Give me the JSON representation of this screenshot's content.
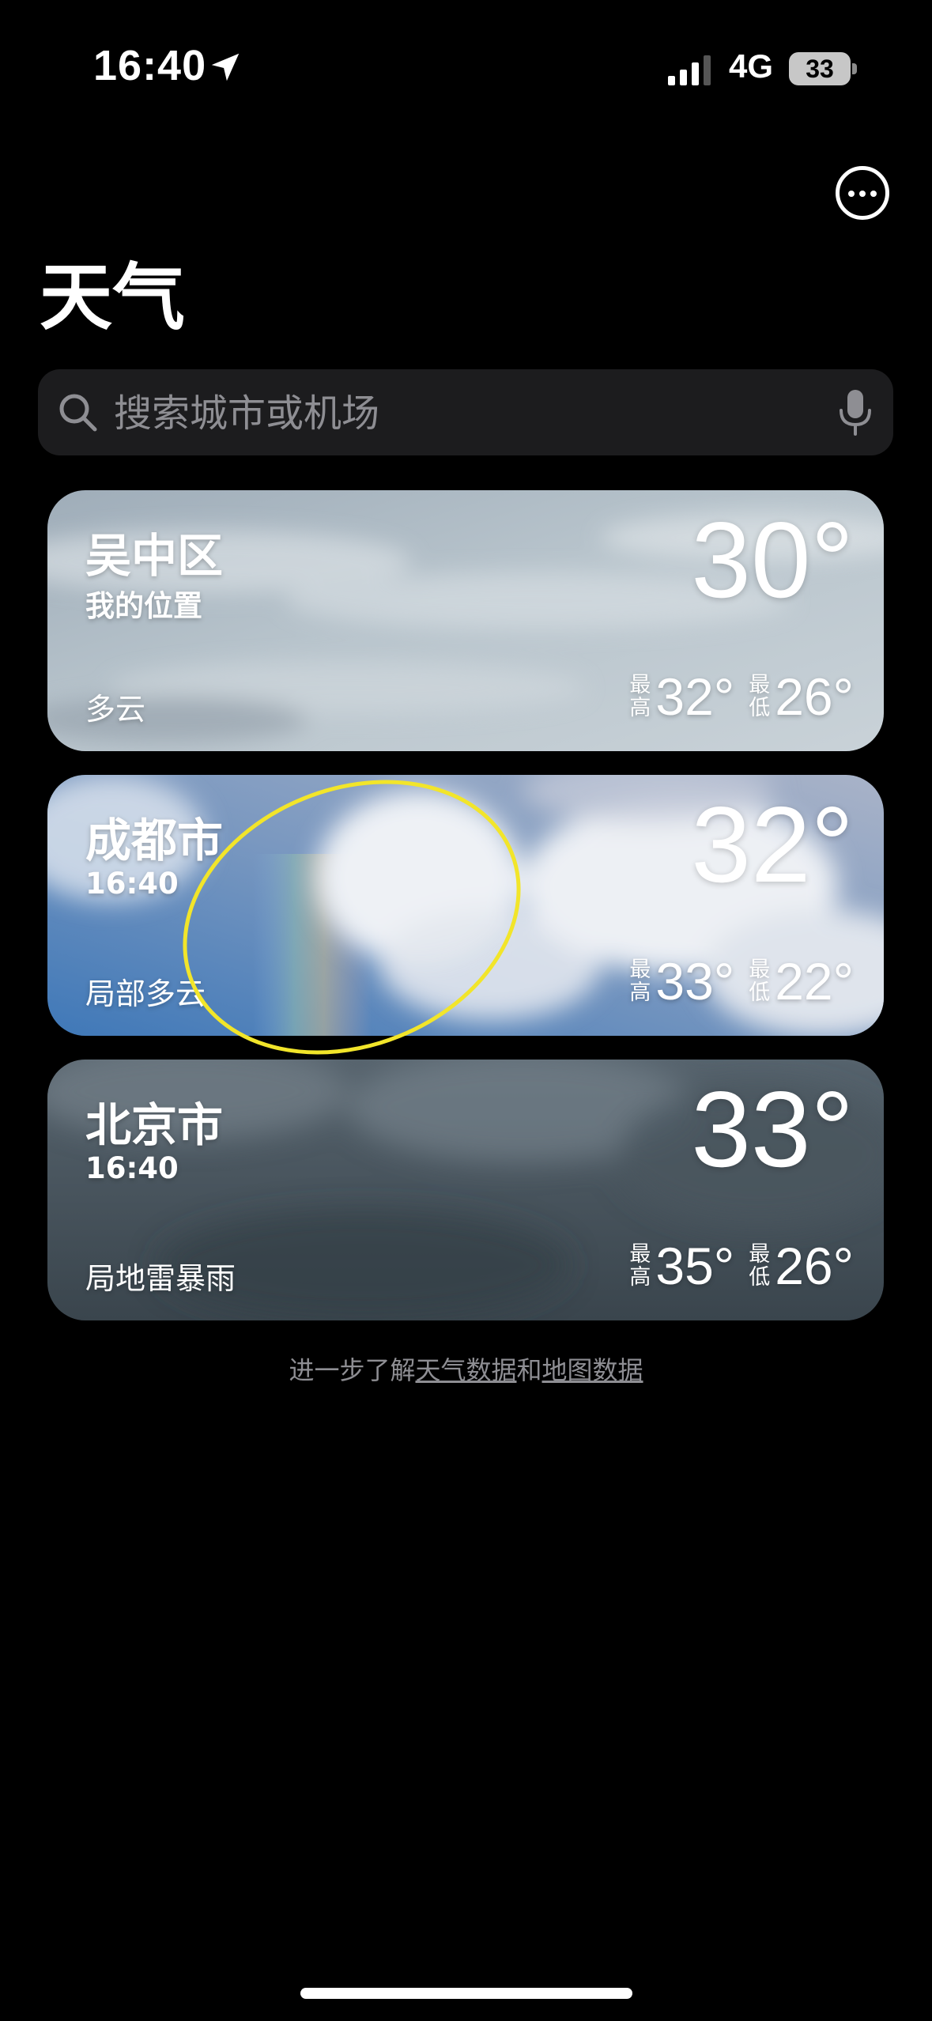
{
  "status_bar": {
    "time": "16:40",
    "network": "4G",
    "battery": "33"
  },
  "header": {
    "title": "天气"
  },
  "search": {
    "placeholder": "搜索城市或机场"
  },
  "cities": [
    {
      "name": "吴中区",
      "subtitle": "我的位置",
      "condition": "多云",
      "temp": "30°",
      "high_label": [
        "最",
        "高"
      ],
      "high": "32°",
      "low_label": [
        "最",
        "低"
      ],
      "low": "26°"
    },
    {
      "name": "成都市",
      "subtitle": "16:40",
      "condition": "局部多云",
      "temp": "32°",
      "high_label": [
        "最",
        "高"
      ],
      "high": "33°",
      "low_label": [
        "最",
        "低"
      ],
      "low": "22°"
    },
    {
      "name": "北京市",
      "subtitle": "16:40",
      "condition": "局地雷暴雨",
      "temp": "33°",
      "high_label": [
        "最",
        "高"
      ],
      "high": "35°",
      "low_label": [
        "最",
        "低"
      ],
      "low": "26°"
    }
  ],
  "footer": {
    "prefix": "进一步了解",
    "weather_link": "天气数据",
    "and": "和",
    "map_link": "地图数据"
  },
  "colors": {
    "background": "#000000",
    "search_bg": "#1c1c1e",
    "placeholder": "#8e8e93",
    "annotation": "#f2e52a"
  }
}
